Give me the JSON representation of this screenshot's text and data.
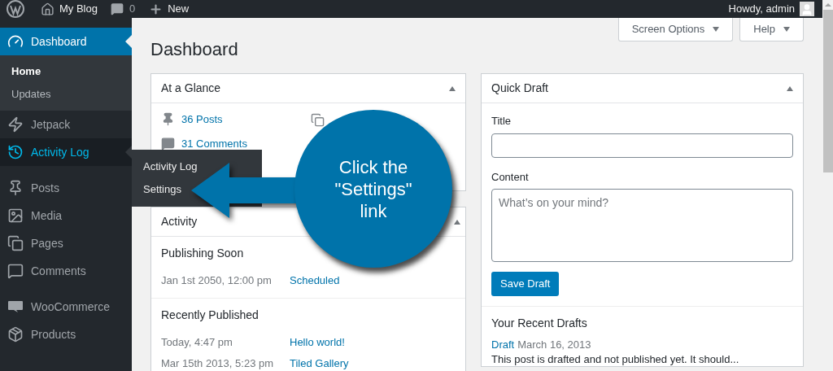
{
  "admin_bar": {
    "site": "My Blog",
    "comments": "0",
    "new": "New",
    "greeting": "Howdy, admin"
  },
  "sidebar": {
    "items": [
      {
        "label": "Dashboard",
        "selected": true,
        "hovered": false,
        "children": [
          {
            "label": "Home",
            "selected": true
          },
          {
            "label": "Updates",
            "selected": false
          }
        ]
      },
      {
        "label": "Jetpack",
        "selected": false,
        "hovered": false
      },
      {
        "label": "Activity Log",
        "selected": false,
        "hovered": true
      },
      {
        "label": "Posts",
        "selected": false,
        "hovered": false
      },
      {
        "label": "Media",
        "selected": false,
        "hovered": false
      },
      {
        "label": "Pages",
        "selected": false,
        "hovered": false
      },
      {
        "label": "Comments",
        "selected": false,
        "hovered": false
      },
      {
        "label": "WooCommerce",
        "selected": false,
        "hovered": false
      },
      {
        "label": "Products",
        "selected": false,
        "hovered": false
      }
    ]
  },
  "flyout_menu": {
    "items": [
      "Activity Log",
      "Settings"
    ]
  },
  "callout": {
    "lines": [
      "Click the",
      "\"Settings\"",
      "link"
    ]
  },
  "header_buttons": [
    "Screen Options",
    "Help"
  ],
  "page_title": "Dashboard",
  "at_a_glance": {
    "title": "At a Glance",
    "items": [
      "36 Posts",
      "31 Comments"
    ]
  },
  "activity": {
    "title": "Activity",
    "sections": [
      {
        "heading": "Publishing Soon",
        "rows": [
          {
            "date": "Jan 1st 2050, 12:00 pm",
            "link": "Scheduled"
          }
        ]
      },
      {
        "heading": "Recently Published",
        "rows": [
          {
            "date": "Today, 4:47 pm",
            "link": "Hello world!"
          },
          {
            "date": "Mar 15th 2013, 5:23 pm",
            "link": "Tiled Gallery"
          }
        ]
      }
    ]
  },
  "quick_draft": {
    "title": "Quick Draft",
    "title_label": "Title",
    "content_label": "Content",
    "content_placeholder": "What’s on your mind?",
    "save_button": "Save Draft",
    "recent_heading": "Your Recent Drafts",
    "drafts": [
      {
        "link": "Draft",
        "date": "March 16, 2013",
        "excerpt": "This post is drafted and not published yet. It should..."
      }
    ]
  }
}
